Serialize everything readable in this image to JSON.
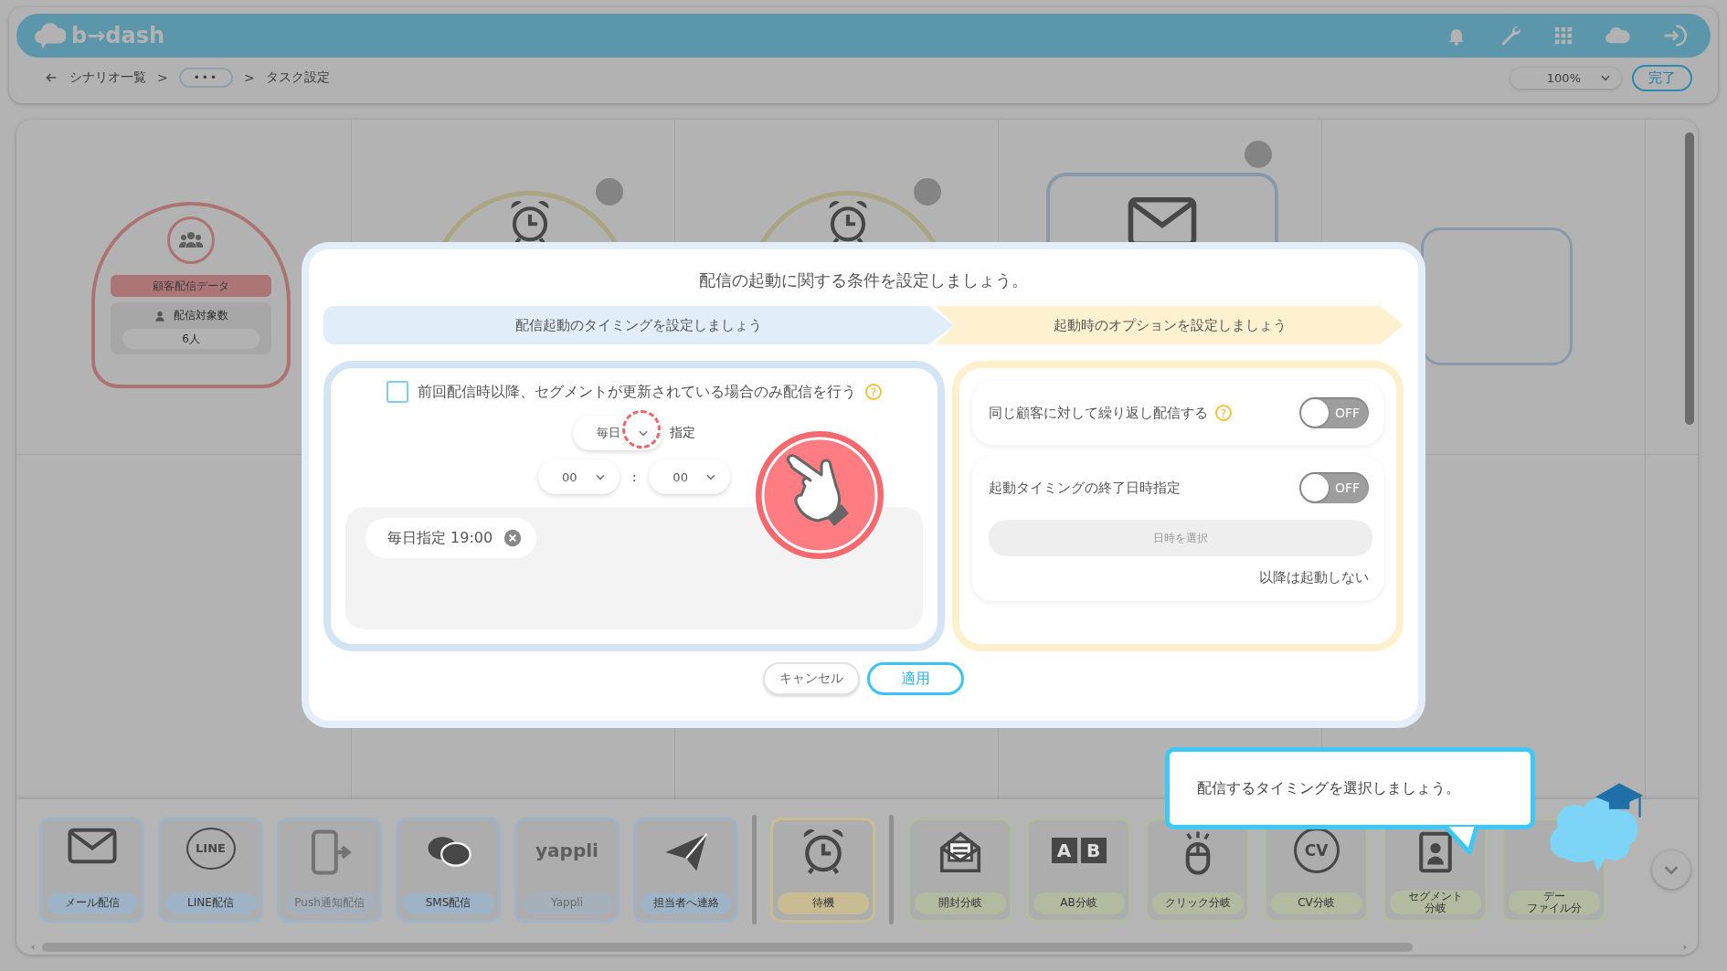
{
  "header": {
    "logo": "b→dash"
  },
  "breadcrumb": [
    {
      "kind": "link",
      "text": "シナリオ一覧"
    },
    {
      "kind": "sep",
      "text": ">"
    },
    {
      "kind": "more",
      "text": "•••"
    },
    {
      "kind": "sep",
      "text": ">"
    },
    {
      "kind": "current",
      "text": "タスク設定"
    }
  ],
  "zoom": {
    "value": "100%"
  },
  "done_button": "完了",
  "canvas": {
    "nodes": [
      {
        "kind": "segment",
        "title": "顧客配信データ",
        "count_label": "配信対象数",
        "count": "6人"
      },
      {
        "kind": "wait"
      },
      {
        "kind": "wait"
      },
      {
        "kind": "mail"
      },
      {
        "kind": "empty"
      }
    ]
  },
  "modal": {
    "title": "配信の起動に関する条件を設定しましょう。",
    "steps": [
      "配信起動のタイミングを設定しましょう",
      "起動時のオプションを設定しましょう"
    ],
    "timing": {
      "checkbox": {
        "label": "前回配信時以降、セグメントが更新されている場合のみ配信を行う",
        "checked": false,
        "help": "?"
      },
      "frequency": {
        "value": "毎日",
        "suffix": "指定"
      },
      "hour": "00",
      "colon": ":",
      "minute": "00",
      "chips": [
        "毎日指定 19:00"
      ]
    },
    "options": [
      {
        "label": "同じ顧客に対して繰り返し配信する",
        "help": "?",
        "on": false,
        "state_text": "OFF"
      },
      {
        "label": "起動タイミングの終了日時指定",
        "on": false,
        "state_text": "OFF",
        "placeholder": "日時を選択",
        "note": "以降は起動しない"
      }
    ],
    "buttons": [
      {
        "kind": "secondary",
        "label": "キャンセル"
      },
      {
        "kind": "primary",
        "label": "適用"
      }
    ]
  },
  "tooltip": "配信するタイミングを選択しましょう。",
  "palette": {
    "groups": [
      {
        "color": "#9fb3c6",
        "items": [
          {
            "kind": "mail",
            "label": [
              "メール配信"
            ],
            "disabled": false
          },
          {
            "kind": "line",
            "icon_text": "LINE",
            "label": [
              "LINE配信"
            ],
            "disabled": false
          },
          {
            "kind": "push",
            "label": [
              "Push通知配信"
            ],
            "disabled": true
          },
          {
            "kind": "sms",
            "label": [
              "SMS配信"
            ],
            "disabled": false
          },
          {
            "kind": "yappli",
            "icon_text": "yappli",
            "label": [
              "Yappli"
            ],
            "disabled": true
          },
          {
            "kind": "contact",
            "label": [
              "担当者へ連絡"
            ],
            "disabled": false
          }
        ]
      },
      {
        "color": "#c8bc92",
        "items": [
          {
            "kind": "wait",
            "label": [
              "待機"
            ],
            "disabled": false
          }
        ]
      },
      {
        "color": "#b2baa0",
        "items": [
          {
            "kind": "open",
            "label": [
              "開封分岐"
            ],
            "disabled": false
          },
          {
            "kind": "ab",
            "icon_text": [
              "A",
              "B"
            ],
            "label": [
              "AB分岐"
            ],
            "disabled": false
          },
          {
            "kind": "click",
            "label": [
              "クリック分岐"
            ],
            "disabled": false
          },
          {
            "kind": "cv",
            "icon_text": "CV",
            "label": [
              "CV分岐"
            ],
            "disabled": false
          },
          {
            "kind": "segment",
            "label": [
              "セグメント",
              "分岐"
            ],
            "disabled": false
          },
          {
            "kind": "file",
            "label": [
              "デー",
              "ファイル分"
            ],
            "disabled": false
          }
        ]
      }
    ]
  }
}
